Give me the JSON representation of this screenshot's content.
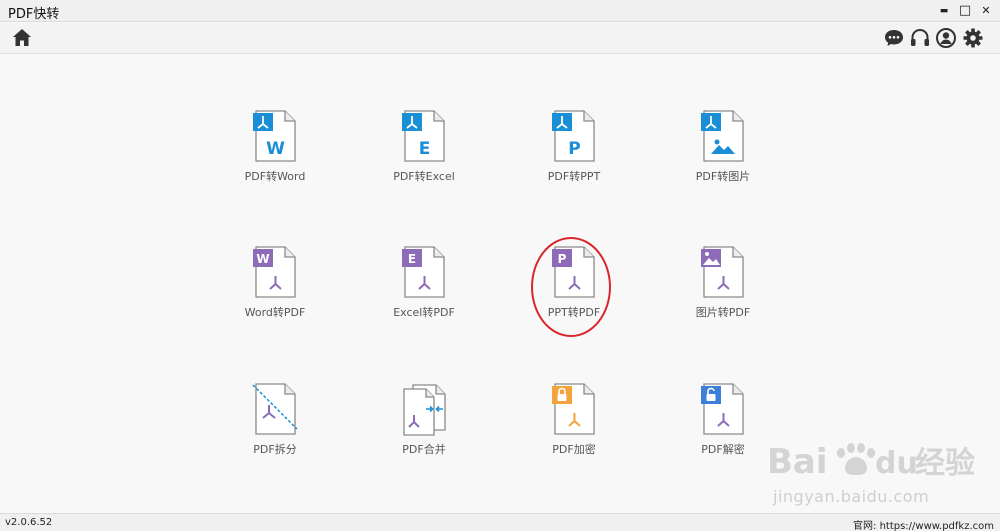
{
  "window": {
    "title": "PDF快转",
    "minimize_glyph": "▬",
    "maximize_glyph": "□",
    "close_glyph": "✕"
  },
  "toolbar": {
    "home_icon": "home-icon",
    "right_icons": [
      "chat-icon",
      "headset-icon",
      "user-icon",
      "gear-icon"
    ]
  },
  "colors": {
    "blue": "#1a8fd6",
    "purple": "#8e6bb8",
    "orange": "#f3a33c",
    "accent_red": "#d8262b"
  },
  "tools": {
    "row1": [
      {
        "label": "PDF转Word",
        "badge": "W"
      },
      {
        "label": "PDF转Excel",
        "badge": "E"
      },
      {
        "label": "PDF转PPT",
        "badge": "P"
      },
      {
        "label": "PDF转图片",
        "badge": "image"
      }
    ],
    "row2": [
      {
        "label": "Word转PDF",
        "badge": "W"
      },
      {
        "label": "Excel转PDF",
        "badge": "E"
      },
      {
        "label": "PPT转PDF",
        "badge": "P"
      },
      {
        "label": "图片转PDF",
        "badge": "image"
      }
    ],
    "row3": [
      {
        "label": "PDF拆分",
        "badge": "split"
      },
      {
        "label": "PDF合并",
        "badge": "merge"
      },
      {
        "label": "PDF加密",
        "badge": "lock"
      },
      {
        "label": "PDF解密",
        "badge": "unlock"
      }
    ]
  },
  "status": {
    "version": "v2.0.6.52",
    "website_label": "官网:",
    "website_url": "https://www.pdfkz.com"
  },
  "watermark": {
    "logo_text": "Bai",
    "logo_text2": "du",
    "logo_cn": "经验",
    "url": "jingyan.baidu.com"
  }
}
